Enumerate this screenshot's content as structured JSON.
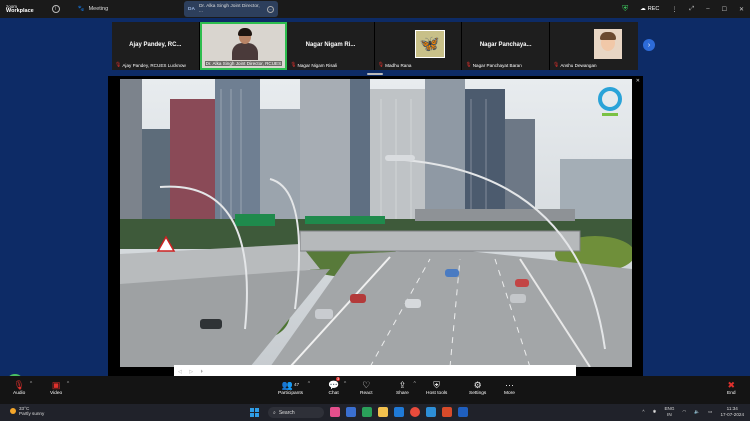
{
  "window": {
    "app_name_line1": "zoom",
    "app_name_line2": "Workplace",
    "meeting_label": "Meeting",
    "tab_initials": "DA",
    "tab_label": "Dr. Alka Singh Joint Director, ...",
    "rec_label": "REC"
  },
  "gallery": {
    "tiles": [
      {
        "big_name": "Ajay Pandey, RC...",
        "small_name": "Ajay Pandey, RCUES Lucknow"
      },
      {
        "big_name": "",
        "small_name": "Dr. Alka Singh Joint Director, RCUES"
      },
      {
        "big_name": "Nagar Nigam Ri...",
        "small_name": "Nagar Nigam Risali"
      },
      {
        "big_name": "",
        "small_name": "Madhu Rana"
      },
      {
        "big_name": "Nagar Panchaya...",
        "small_name": "Nagar Panchayat Baran"
      },
      {
        "big_name": "",
        "small_name": "Anshu Dewangan"
      }
    ]
  },
  "toolbar": {
    "audio": "Audio",
    "video": "Video",
    "participants": "Participants",
    "participants_count": "47",
    "chat": "Chat",
    "chat_badge": "3",
    "react": "React",
    "share": "Share",
    "host_tools": "Host tools",
    "settings": "Settings",
    "more": "More",
    "end": "End"
  },
  "taskbar": {
    "temp": "33°C",
    "weather": "Partly sunny",
    "search_placeholder": "Search",
    "lang_line1": "ENG",
    "lang_line2": "IN",
    "time": "11:34",
    "date": "17-07-2024"
  },
  "colors": {
    "main_bg": "#0d2b66",
    "active_tile_border": "#2dbd4e",
    "accent_blue": "#2d6bd8",
    "end_red": "#e0302c"
  }
}
